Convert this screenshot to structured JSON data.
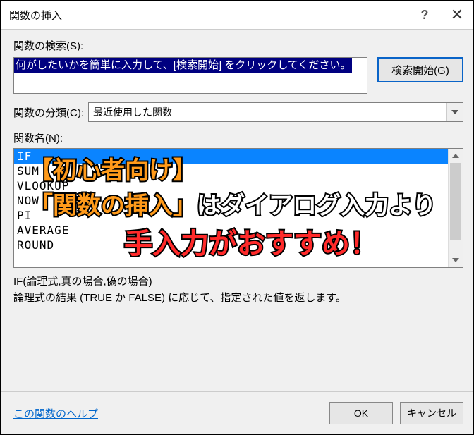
{
  "titlebar": {
    "title": "関数の挿入"
  },
  "search": {
    "label": "関数の検索(S):",
    "placeholder_text": "何がしたいかを簡単に入力して、[検索開始] をクリックしてください。",
    "button": "検索開始(G)"
  },
  "category": {
    "label": "関数の分類(C):",
    "selected": "最近使用した関数"
  },
  "select_fn_label": "関数名(N):",
  "functions": [
    "IF",
    "SUM",
    "VLOOKUP",
    "NOW",
    "PI",
    "AVERAGE",
    "ROUND"
  ],
  "signature": "IF(論理式,真の場合,偽の場合)",
  "description": "論理式の結果 (TRUE か FALSE) に応じて、指定された値を返します。",
  "help_link": "この関数のヘルプ",
  "buttons": {
    "ok": "OK",
    "cancel": "キャンセル"
  },
  "overlay": {
    "line1": "【初心者向け】",
    "line2a": "「関数の挿入」",
    "line2b": "はダイアログ入力より",
    "line3": "手入力がおすすめ！"
  }
}
